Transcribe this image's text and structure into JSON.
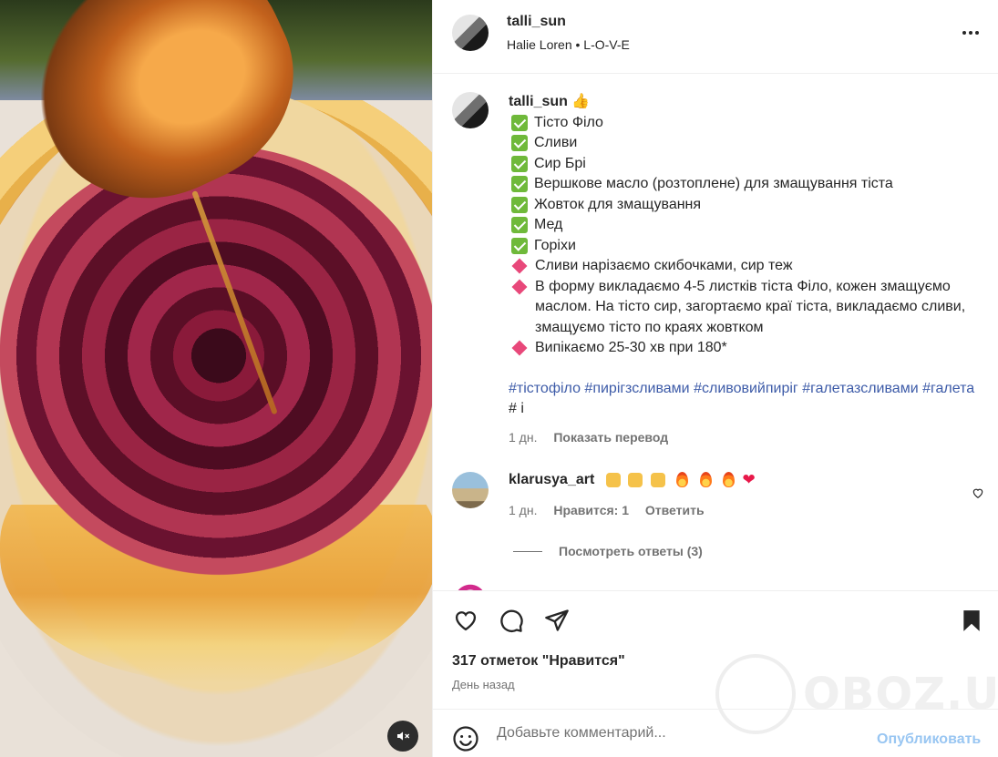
{
  "post": {
    "username": "talli_sun",
    "subtitle": "Halie Loren • L-O-V-E"
  },
  "caption": {
    "username": "talli_sun",
    "user_emoji": "👍",
    "ingredients": [
      "Тісто Філо",
      "Сливи",
      "Сир Брі",
      "Вершкове масло (розтоплене) для змащування тіста",
      "Жовток для змащування",
      "Мед",
      "Горіхи"
    ],
    "steps": [
      "Сливи нарізаємо скибочками, сир теж",
      "В форму викладаємо 4-5 листків тіста Філо, кожен змащуємо маслом. На тісто сир, загортаємо краї тіста, викладаємо сливи, змащуємо тісто по краях жовтком",
      "Випікаємо 25-30 хв при 180*"
    ],
    "hashtags": [
      "#тістофіло",
      "#пирігзсливами",
      "#сливовийпиріг",
      "#галетазсливами",
      "#галета"
    ],
    "hashtag_tail": "# і",
    "time": "1 дн.",
    "translate": "Показать перевод"
  },
  "comment": {
    "username": "klarusya_art",
    "time": "1 дн.",
    "likes": "Нравится: 1",
    "reply": "Ответить",
    "view_replies": "Посмотреть ответы (3)"
  },
  "actions": {
    "likes_count": "317 отметок \"Нравится\"",
    "posted_when": "День назад"
  },
  "watermark": "OBOZ.UA",
  "comment_box": {
    "placeholder": "Добавьте комментарий...",
    "post_label": "Опубликовать"
  },
  "colors": {
    "link": "#3d5ba8",
    "post_button": "#99c6f2",
    "check": "#6fb93a",
    "diamond": "#e8487a"
  }
}
